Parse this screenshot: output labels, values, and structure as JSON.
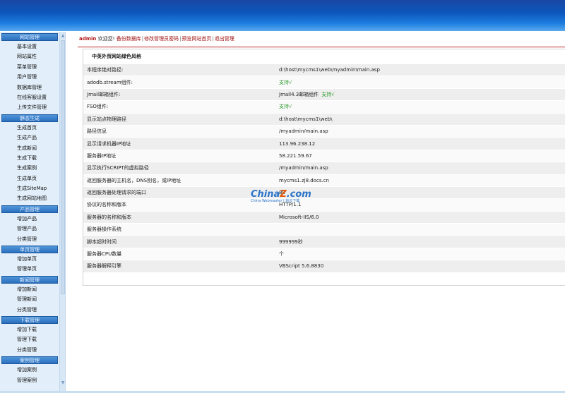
{
  "sidebar": {
    "groups": [
      {
        "title": "网站管理",
        "items": [
          "基本设置",
          "网站属性",
          "菜单管理",
          "用户管理",
          "数据库管理",
          "在线客服设置",
          "上传文件管理"
        ]
      },
      {
        "title": "静态生成",
        "items": [
          "生成首页",
          "生成产品",
          "生成新闻",
          "生成下载",
          "生成案例",
          "生成单页",
          "生成SiteMap",
          "生成网站地图"
        ]
      },
      {
        "title": "产品管理",
        "items": [
          "增加产品",
          "管理产品",
          "分类管理"
        ]
      },
      {
        "title": "单页管理",
        "items": [
          "增加单页",
          "管理单页"
        ]
      },
      {
        "title": "新闻管理",
        "items": [
          "增加新闻",
          "管理新闻",
          "分类管理"
        ]
      },
      {
        "title": "下载管理",
        "items": [
          "增加下载",
          "管理下载",
          "分类管理"
        ]
      },
      {
        "title": "案例管理",
        "items": [
          "增加案例",
          "管理案例"
        ]
      }
    ]
  },
  "toplinks": {
    "user": "admin",
    "welcome": "欢迎您!",
    "links": [
      "备份数据库",
      "修改管理员密码",
      "预览网站首页",
      "退出管理"
    ],
    "separator": "|"
  },
  "panel": {
    "title": "中英外贸网站绿色风格",
    "rows": [
      {
        "label": "本程序绝对路径:",
        "value": "d:\\host\\mycms1\\web\\myadmin\\main.asp"
      },
      {
        "label": "adodb.stream组件:",
        "value": "支持√",
        "green": true
      },
      {
        "label": "Jmail邮箱组件:",
        "value": "Jmail4.3邮箱组件",
        "extra": "支持√"
      },
      {
        "label": "FSO组件:",
        "value": "支持√",
        "green": true
      },
      {
        "label": "显示站点物理路径",
        "value": "d:\\host\\mycms1\\web\\"
      },
      {
        "label": "路径信息",
        "value": "/myadmin/main.asp"
      },
      {
        "label": "显示请求机器IP地址",
        "value": "113.96.238.12"
      },
      {
        "label": "服务器IP地址",
        "value": "58.221.59.67"
      },
      {
        "label": "显示执行SCRIPT的虚拟路径",
        "value": "/myadmin/main.asp"
      },
      {
        "label": "返回服务器的主机名，DNS别名，或IP地址",
        "value": "mycms1.zj8.docs.cn"
      },
      {
        "label": "返回服务器处理请求的端口",
        "value": "80"
      },
      {
        "label": "协议的名称和版本",
        "value": "HTTP/1.1"
      },
      {
        "label": "服务器的名称和版本",
        "value": "Microsoft-IIS/6.0"
      },
      {
        "label": "服务器操作系统",
        "value": ""
      },
      {
        "label": "脚本超时时间",
        "value": "999999秒"
      },
      {
        "label": "服务器CPU数量",
        "value": "个"
      },
      {
        "label": "服务器解释引擎",
        "value": "VBScript 5.6.8830"
      }
    ]
  },
  "watermark": {
    "brand": "China",
    "brand_z": "Z",
    ".com": ".com",
    "sub": "China Webmaster | 站长下载"
  },
  "colors": {
    "topbar": "#0c56bb",
    "sidebar_bg": "#e2eef9",
    "group_head": "#2b6fbd",
    "link_red": "#b01818",
    "ok_green": "#2a9a2a"
  }
}
